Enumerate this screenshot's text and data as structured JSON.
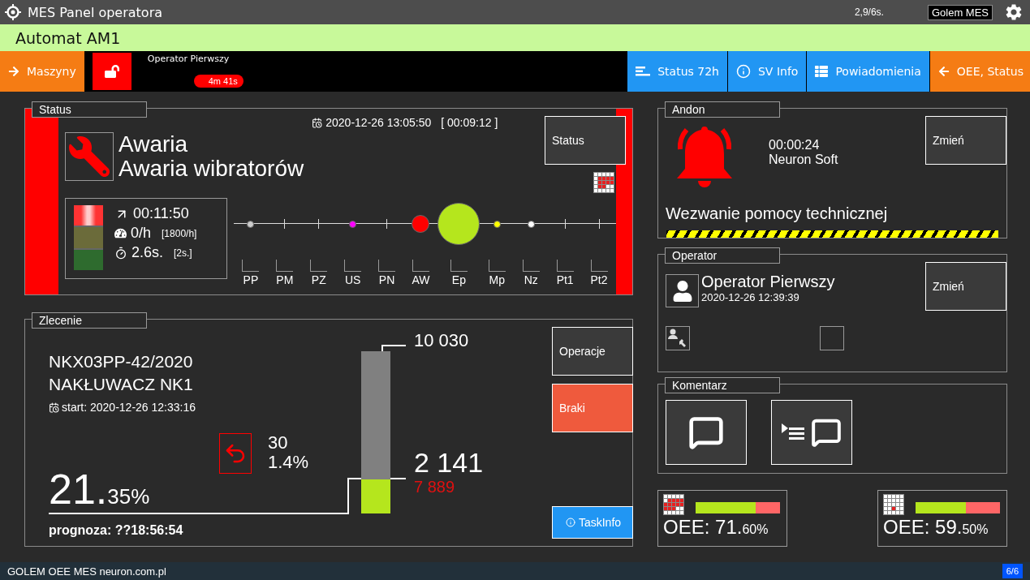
{
  "header": {
    "title": "MES Panel operatora",
    "refresh": "2,9/6s.",
    "system": "Golem MES"
  },
  "machine": {
    "name": "Automat AM1"
  },
  "nav": {
    "left_button": {
      "label": "Maszyny",
      "color": "#f57c14"
    },
    "locked": false,
    "operator": "Operator Pierwszy",
    "timer": "4m 41s",
    "buttons": [
      {
        "label": "Status 72h",
        "color": "#2196f3"
      },
      {
        "label": "SV Info",
        "color": "#2196f3"
      },
      {
        "label": "Powiadomienia",
        "color": "#2196f3"
      },
      {
        "label": "OEE, Status",
        "color": "#f57c14"
      }
    ]
  },
  "status": {
    "legend": "Status",
    "color": "#ff0000",
    "datetime": "2020-12-26 13:05:50",
    "duration": "[ 00:09:12 ]",
    "title": "Awaria",
    "reason": "Awaria wibratorów",
    "button": "Status",
    "elapsed": "00:11:50",
    "rate": "0/h",
    "rate_norm": "[1800/h]",
    "cycle": "2.6s.",
    "cycle_norm": "[2s.]",
    "states": [
      {
        "label": "PP",
        "kind": "dot",
        "color": "#cccccc"
      },
      {
        "label": "PM",
        "kind": "tick"
      },
      {
        "label": "PZ",
        "kind": "tick"
      },
      {
        "label": "US",
        "kind": "dot",
        "color": "#ff00ff"
      },
      {
        "label": "PN",
        "kind": "tick"
      },
      {
        "label": "AW",
        "kind": "marker",
        "color": "#ff0000"
      },
      {
        "label": "Ep",
        "kind": "current",
        "color": "#b5e61d"
      },
      {
        "label": "Mp",
        "kind": "dot",
        "color": "#ffff00"
      },
      {
        "label": "Nz",
        "kind": "dot",
        "color": "#ffffff"
      },
      {
        "label": "Pt1",
        "kind": "tick"
      },
      {
        "label": "Pt2",
        "kind": "tick"
      }
    ]
  },
  "order": {
    "legend": "Zlecenie",
    "number": "NKX03PP-42/2020",
    "product": "NAKŁUWACZ NK1",
    "start": "start: 2020-12-26 12:33:16",
    "scrap_count": "30",
    "scrap_percent": "1.4%",
    "progress_whole": "21.",
    "progress_fraction": "35%",
    "forecast": "prognoza: ??18:56:54",
    "target": "10 030",
    "done": "2 141",
    "remaining": "7 889",
    "level": 0.21,
    "buttons": [
      {
        "label": "Operacje",
        "kind": "default"
      },
      {
        "label": "Braki",
        "kind": "alert"
      },
      {
        "label": "TaskInfo",
        "kind": "info"
      }
    ]
  },
  "andon": {
    "legend": "Andon",
    "time": "00:00:24",
    "source": "Neuron Soft",
    "message": "Wezwanie pomocy technicznej",
    "button": "Zmień"
  },
  "operator": {
    "legend": "Operator",
    "name": "Operator Pierwszy",
    "since": "2020-12-26 12:39:39",
    "button": "Zmień"
  },
  "comment": {
    "legend": "Komentarz"
  },
  "oee": [
    {
      "label": "OEE:",
      "whole": "71.",
      "fraction": "60%",
      "level": 0.716
    },
    {
      "label": "OEE:",
      "whole": "59.",
      "fraction": "50%",
      "level": 0.595
    }
  ],
  "footer": {
    "text": "GOLEM OEE MES neuron.com.pl",
    "page": "6/6"
  }
}
